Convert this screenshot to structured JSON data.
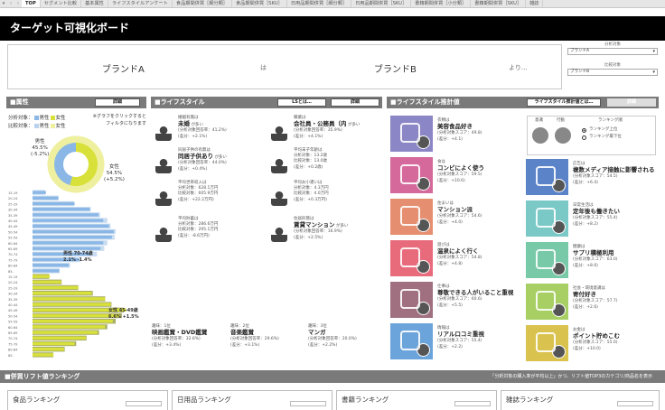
{
  "tabs": [
    "TOP",
    "セグメント比較",
    "基本属性",
    "ライフスタイルアンケート",
    "食品期間併買［細分類］",
    "食品期間併買［SKU］",
    "日用品期間併買［細分類］",
    "日用品期間併買［SKU］",
    "書籍期間併買［小分類］",
    "書籍期間併買［SKU］",
    "雑誌"
  ],
  "title": "ターゲット可視化ボード",
  "compare": {
    "brand_a": "ブランドA",
    "wa": "は",
    "brand_b": "ブランドB",
    "yori": "より...",
    "target_label": "分析対象",
    "target_value": "ブランドA",
    "compare_label": "比較対象",
    "compare_value": "ブランドB"
  },
  "attributes": {
    "header": "属性",
    "detail_btn": "詳細",
    "legend_line1_prefix": "分析対象：",
    "legend_line2_prefix": "比較対象：",
    "male": "男性",
    "female": "女性",
    "note": "※グラフをクリックすると\nフィルタになります",
    "male_label": "男性\n45.5%\n(-5.2%)",
    "female_label": "女性\n54.5%\n(+5.2%)",
    "male_age_label": "男性 70-74歳\n2.1% -1.4%",
    "female_age_label": "女性 45-49歳\n6.6% +1.5%",
    "age_ticks": [
      "15-19",
      "20-24",
      "25-29",
      "30-34",
      "35-39",
      "40-44",
      "45-49",
      "50-54",
      "55-59",
      "60-64",
      "65-69",
      "70-74",
      "75-79",
      "80-84",
      "85-",
      "15-19",
      "20-24",
      "25-29",
      "30-34",
      "35-39",
      "40-44",
      "45-49",
      "50-54",
      "55-59",
      "60-64",
      "65-69",
      "70-74",
      "75-79",
      "80-84",
      "85-"
    ],
    "male_bars": [
      0.14,
      0.27,
      0.44,
      0.6,
      0.69,
      0.74,
      0.8,
      0.85,
      0.83,
      0.74,
      0.71,
      0.6,
      0.48,
      0.38,
      0.28
    ],
    "female_bars": [
      0.18,
      0.3,
      0.48,
      0.62,
      0.76,
      0.82,
      0.98,
      0.91,
      0.84,
      0.76,
      0.68,
      0.56,
      0.44,
      0.33,
      0.22
    ],
    "male_bars_compare": [
      0.12,
      0.25,
      0.4,
      0.56,
      0.65,
      0.72,
      0.75,
      0.8,
      0.79,
      0.72,
      0.69,
      0.62,
      0.46,
      0.36,
      0.26
    ],
    "female_bars_compare": [
      0.16,
      0.28,
      0.44,
      0.58,
      0.7,
      0.76,
      0.88,
      0.86,
      0.8,
      0.72,
      0.64,
      0.52,
      0.42,
      0.31,
      0.2
    ],
    "male_color": "#8ab7e6",
    "female_color": "#d8e03a",
    "male_share": 0.455,
    "female_share": 0.545
  },
  "lifestyle": {
    "header": "ライフスタイル",
    "ls_btn": "LSとは…",
    "detail_btn": "詳細",
    "items": [
      {
        "icon": "couple-icon",
        "t1": "婚姻有無は",
        "v": "未婚",
        "suffix": "が多い",
        "l3": "(分析対象回答率：41.2%)",
        "l4": "(差分：+2.1%)"
      },
      {
        "icon": "worker-icon",
        "t1": "職業は",
        "v": "会社員・公務員（内",
        "suffix": "が多い",
        "l3": "(分析対象回答率：35.9%)",
        "l4": "(差分：+4.1%)"
      },
      {
        "icon": "family-icon",
        "t1": "同居子供の有無は",
        "v": "同居子供あり",
        "suffix": "が多い",
        "l3": "(分析対象回答率：44.0%)",
        "l4": "(差分：+0.4%)"
      },
      {
        "icon": "child-icon",
        "t1": "平均末子年齢は",
        "v": "",
        "suffix": "",
        "l3": "分析対象：13.2歳",
        "l4": "比較対象：13.0歳",
        "l5": "(差分：+0.2歳)"
      },
      {
        "icon": "wallet-icon",
        "t1": "平均世帯収入は",
        "v": "",
        "suffix": "",
        "l3": "分析対象：628.1万円",
        "l4": "比較対象：605.9万円",
        "l5": "(差分：+22.2万円)"
      },
      {
        "icon": "money-hand-icon",
        "t1": "平均お小遣いは",
        "v": "",
        "suffix": "",
        "l3": "分析対象：4.3万円",
        "l4": "比較対象：4.0万円",
        "l5": "(差分：+0.3万円)"
      },
      {
        "icon": "piggy-bank-icon",
        "t1": "平均貯蓄は",
        "v": "",
        "suffix": "",
        "l3": "分析対象：286.6万円",
        "l4": "比較対象：295.1万円",
        "l5": "(差分：-8.6万円)"
      },
      {
        "icon": "house-icon",
        "t1": "住居形態は",
        "v": "賃貸マンション",
        "suffix": "が多い",
        "l3": "(分析対象回答率：16.9%)",
        "l4": "(差分：+2.5%)"
      }
    ],
    "hobbies": [
      {
        "t1": "趣味：1位",
        "v": "映画鑑賞・DVD鑑賞",
        "l3": "(分析対象回答率：32.6%)",
        "l4": "(差分：+3.4%)"
      },
      {
        "t1": "趣味：2位",
        "v": "音楽鑑賞",
        "l3": "(分析対象回答率：29.6%)",
        "l4": "(差分：+3.1%)"
      },
      {
        "t1": "趣味：3位",
        "v": "マンガ",
        "l3": "(分析対象回答率：20.0%)",
        "l4": "(差分：+2.2%)"
      }
    ]
  },
  "estimate": {
    "header": "ライフスタイル推計値",
    "about_btn": "ライフスタイル推計値とは…",
    "detail_btn": "詳細",
    "legend": {
      "c1": "意識",
      "c2": "行動",
      "rank_label": "ランキング順",
      "opt1": "ランキング上位",
      "opt2": "ランキング最下位"
    },
    "left_tiles": [
      {
        "icon": "tshirt-icon",
        "color": "#8b86c5",
        "t1": "衣類は",
        "v": "美容食品好き",
        "l3": "(分析対象スコア：49.8)",
        "l4": "(差分：+4.1)"
      },
      {
        "icon": "food-icon",
        "color": "#d5699b",
        "t1": "食は",
        "v": "コンビによく使う",
        "l3": "(分析対象スコア：59.5)",
        "l4": "(差分：+10.6)"
      },
      {
        "icon": "house-tile-icon",
        "color": "#e58f70",
        "t1": "住まいは",
        "v": "マンション派",
        "l3": "(分析対象スコア：54.6)",
        "l4": "(差分：+4.0)"
      },
      {
        "icon": "gamepad-icon",
        "color": "#e86b7c",
        "t1": "遊びは",
        "v": "温泉によく行く",
        "l3": "(分析対象スコア：54.8)",
        "l4": "(差分：+4.8)"
      },
      {
        "icon": "briefcase-icon",
        "color": "#a07080",
        "t1": "仕事は",
        "v": "尊敬できる人がいること重視",
        "l3": "(分析対象スコア：60.6)",
        "l4": "(差分：+5.5)"
      },
      {
        "icon": "newspaper-icon",
        "color": "#6aa4db",
        "t1": "情報は",
        "v": "リアル口コミ重視",
        "l3": "(分析対象スコア：55.4)",
        "l4": "(差分：+2.2)"
      }
    ],
    "right_tiles": [
      {
        "icon": "megaphone-icon",
        "color": "#5b83c8",
        "t1": "広告は",
        "v": "複数メディア接触に影響される",
        "l3": "(分析対象スコア：54.5)",
        "l4": "(差分：+6.4)"
      },
      {
        "icon": "walking-icon",
        "color": "#7ac9c7",
        "t1": "日常生活は",
        "v": "定年後も働きたい",
        "l3": "(分析対象スコア：55.4)",
        "l4": "(差分：+8.2)"
      },
      {
        "icon": "health-icon",
        "color": "#78c9a8",
        "t1": "健康は",
        "v": "サプリ積極利用",
        "l3": "(分析対象スコア：63.0)",
        "l4": "(差分：+8.6)"
      },
      {
        "icon": "social-icon",
        "color": "#a7cf63",
        "t1": "社会・環境意識は",
        "v": "寄付好き",
        "l3": "(分析対象スコア：57.7)",
        "l4": "(差分：+2.6)"
      },
      {
        "icon": "yen-coins-icon",
        "color": "#d9c24e",
        "t1": "お金は",
        "v": "ポイント貯めこむ",
        "l3": "(分析対象スコア：55.0)",
        "l4": "(差分：+10.0)"
      }
    ]
  },
  "ranking": {
    "header": "併買リフト値ランキング",
    "note": "「分析対象の購入率が平均以上」かつ、リフト値TOP3のカテゴリ/商品名を表示",
    "boxes": [
      "食品ランキング",
      "日用品ランキング",
      "書籍ランキング",
      "雑誌ランキング"
    ]
  }
}
